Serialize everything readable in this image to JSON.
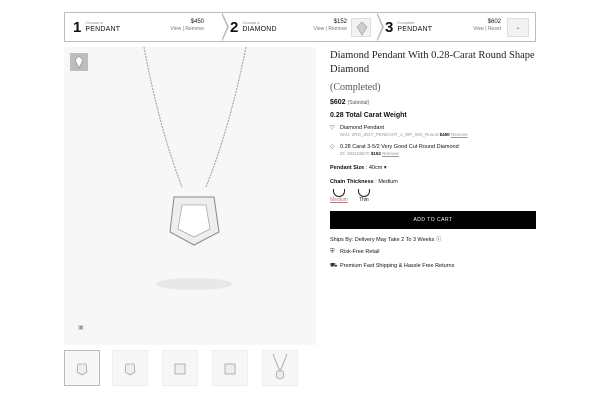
{
  "steps": [
    {
      "num": "1",
      "small": "Choose a",
      "name": "PENDANT",
      "price": "$450",
      "link1": "View",
      "link2": "Remove"
    },
    {
      "num": "2",
      "small": "Choose a",
      "name": "DIAMOND",
      "price": "$152",
      "link1": "View",
      "link2": "Remove"
    },
    {
      "num": "3",
      "small": "Complete",
      "name": "PENDANT",
      "price": "$602",
      "link1": "View",
      "link2": "Reset"
    }
  ],
  "product": {
    "title": "Diamond Pendant With 0.28-Carat Round Shape Diamond",
    "status": "(Completed)",
    "subtotal_price": "$602",
    "subtotal_label": "(Subtotal)",
    "tcw": "0.28 Total Carat Weight",
    "items": [
      {
        "title": "Diamond Pendant",
        "sku_label": "SKU:",
        "sku": "2RG_0017_PENDANT_1_WP_WG_Round",
        "price": "$450",
        "action": "Remove"
      },
      {
        "title": "0.28 Carat 3-5/2 Very Good Cut Round Diamond",
        "sku_label": "ID:",
        "sku": "383198570",
        "price": "$152",
        "action": "Remove"
      }
    ],
    "pendant_size_label": "Pendant Size",
    "pendant_size_value": "40cm",
    "chain_label": "Chain Thickness",
    "chain_value": "Medium",
    "thickness_options": [
      "Medium",
      "Thin"
    ],
    "add_to_cart": "ADD TO CART",
    "ships": "Ships By: Delivery May Take 2 To 3 Weeks",
    "features": [
      "Risk-Free Retail",
      "Premium Fast Shipping & Hassle Free Returns"
    ]
  }
}
